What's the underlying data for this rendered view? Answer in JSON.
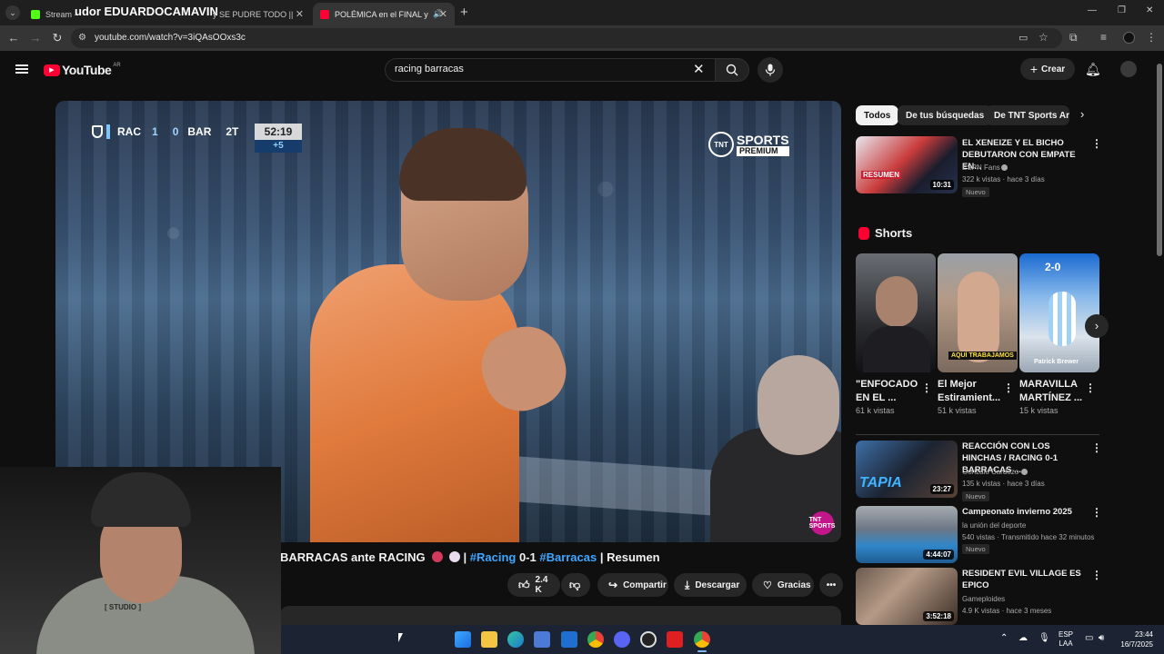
{
  "browser": {
    "tabs": [
      {
        "label": "Stream - ",
        "overlay": "udor EDUARDOCAMAVIN",
        "active": false
      },
      {
        "label": "y SE PUDRE TODO ||",
        "active": false
      },
      {
        "label": "POLÉMICA en el FINAL y TI",
        "active": true
      }
    ],
    "new_tab": "+",
    "url": "youtube.com/watch?v=3iQAsOOxs3c",
    "window_controls": {
      "minimize": "—",
      "restore": "❐",
      "close": "✕"
    }
  },
  "yt": {
    "logo_text": "YouTube",
    "logo_region": "AR",
    "search_value": "racing barracas",
    "create_label": "Crear"
  },
  "video": {
    "score": {
      "home": "RAC",
      "home_goals": "1",
      "away_goals": "0",
      "away": "BAR",
      "period": "2T",
      "clock": "52:19",
      "added": "+5"
    },
    "tnt": {
      "line1": "TNT",
      "line2": "SPORTS",
      "line3": "PREMIUM"
    },
    "bug": "TNT SPORTS",
    "title_start": "BARRACAS ante RACING",
    "title_sep": " | ",
    "tag1": "#Racing",
    "score_text": " 0-1 ",
    "tag2": "#Barracas",
    "title_end": " | Resumen"
  },
  "actions": {
    "likes": "2.4 K",
    "share": "Compartir",
    "download": "Descargar",
    "thanks": "Gracias"
  },
  "webcam": {
    "print": "[ STUDIO ]"
  },
  "sidebar": {
    "chips": [
      "Todos",
      "De tus búsquedas",
      "De TNT Sports Arg"
    ],
    "videos_top": [
      {
        "title": "EL XENEIZE Y EL BICHO DEBUTARON CON EMPATE EN...",
        "channel": "ESPN Fans",
        "meta": "322 k vistas · hace 3 días",
        "badge": "Nuevo",
        "duration": "10:31",
        "thumb_text": "RESUMEN"
      }
    ],
    "shorts_heading": "Shorts",
    "shorts": [
      {
        "title": "\"ENFOCADO EN EL ...",
        "views": "61 k vistas"
      },
      {
        "title": "El Mejor Estiramient...",
        "views": "51 k vistas",
        "thumb_text": "AQUÍ TRABAJAMOS"
      },
      {
        "title": "MARAVILLA MARTÍNEZ ...",
        "views": "15 k vistas",
        "thumb_text": "2-0",
        "thumb_caption": "Patrick Brewer"
      }
    ],
    "videos": [
      {
        "title": "REACCIÓN CON LOS HINCHAS / RACING 0-1 BARRACAS ...",
        "channel": "Gonzalo Cardozo",
        "meta": "135 k vistas · hace 3 días",
        "badge": "Nuevo",
        "duration": "23:27",
        "thumb_text": "TAPIA"
      },
      {
        "title": "Campeonato invierno 2025",
        "channel": "la unión del deporte",
        "meta": "540 vistas · Transmitido hace 32 minutos",
        "badge": "Nuevo",
        "duration": "4:44:07"
      },
      {
        "title": "RESIDENT EVIL VILLAGE ES EPICO",
        "channel": "Gameploides",
        "meta": "4.9 K vistas · hace 3 meses",
        "duration": "3:52:18"
      }
    ]
  },
  "taskbar": {
    "lang": "ESP",
    "lang2": "LAA",
    "time": "23:44",
    "date": "16/7/2025"
  }
}
